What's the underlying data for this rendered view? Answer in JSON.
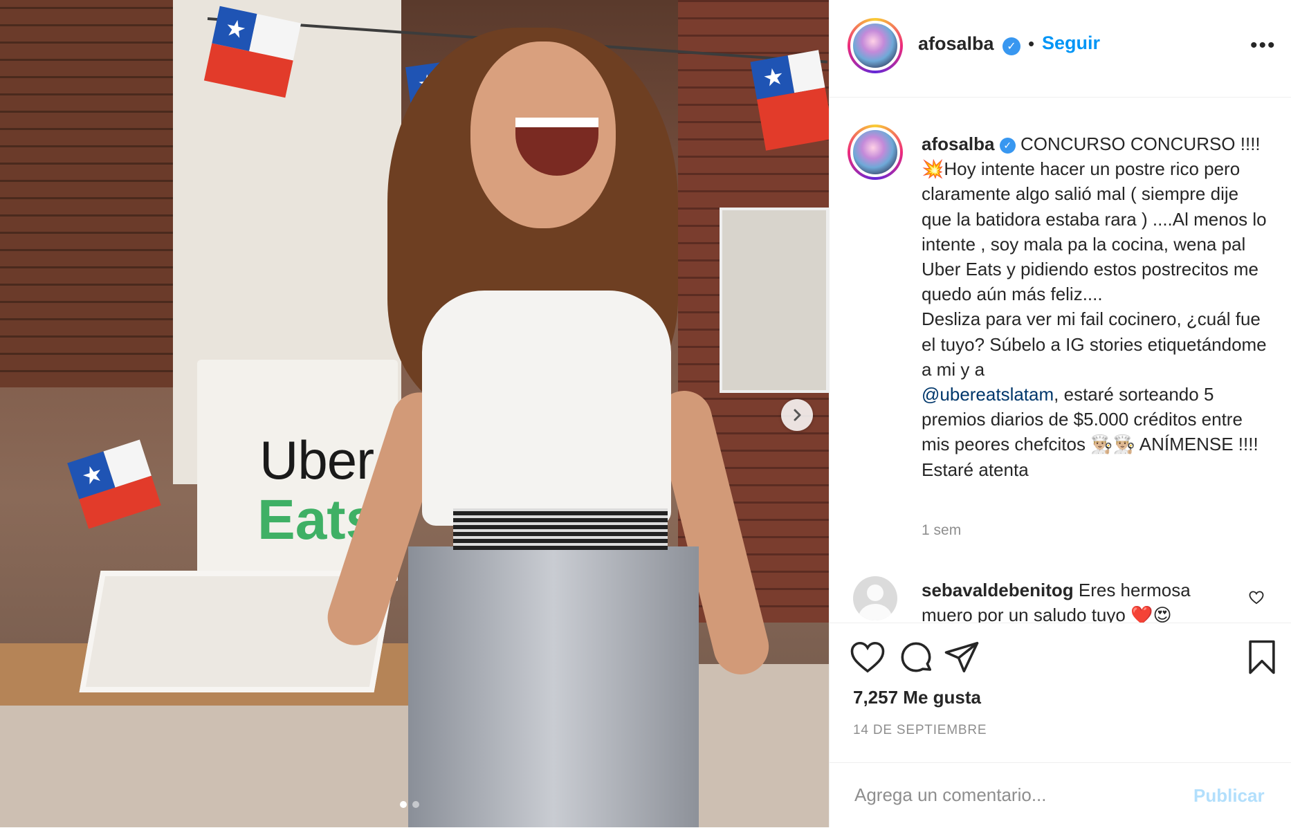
{
  "post_image": {
    "bag_line1": "Uber",
    "bag_line2": "Eats",
    "dots": [
      true,
      false
    ]
  },
  "header": {
    "username": "afosalba",
    "verified_mark": "✓",
    "separator": "•",
    "follow_label": "Seguir",
    "more_label": "•••"
  },
  "caption": {
    "username": "afosalba",
    "text_part1": "CONCURSO CONCURSO !!!!💥Hoy intente hacer un postre rico pero claramente algo salió mal ( siempre dije que la batidora estaba rara ) ....Al menos lo intente , soy mala pa la cocina, wena pal Uber Eats y pidiendo estos postrecitos me quedo aún más feliz....",
    "text_part2": "Desliza para ver mi fail cocinero, ¿cuál fue el tuyo? Súbelo a IG stories etiquetándome a mi y a",
    "mention": "@ubereatslatam",
    "text_part3": ", estaré sorteando 5 premios diarios de $5.000 créditos entre mis peores chefcitos 👨🏼‍🍳👨🏼‍🍳 ANÍMENSE !!!! Estaré atenta",
    "time": "1 sem"
  },
  "comment": {
    "username": "sebavaldebenitog",
    "text": "Eres hermosa muero por un saludo tuyo ❤️😍"
  },
  "actions": {
    "likes": "7,257 Me gusta",
    "date": "14 DE SEPTIEMBRE"
  },
  "comment_bar": {
    "placeholder": "Agrega un comentario...",
    "publish_label": "Publicar"
  },
  "colors": {
    "link_blue": "#0095f6",
    "mention_blue": "#00376b",
    "verified_blue": "#3897f0",
    "muted_gray": "#8e8e8e",
    "publish_disabled": "#b2dffc"
  },
  "icons": [
    "next-arrow-icon",
    "verified-icon",
    "more-options-icon",
    "heart-icon",
    "comment-icon",
    "share-icon",
    "bookmark-icon",
    "small-heart-icon"
  ]
}
